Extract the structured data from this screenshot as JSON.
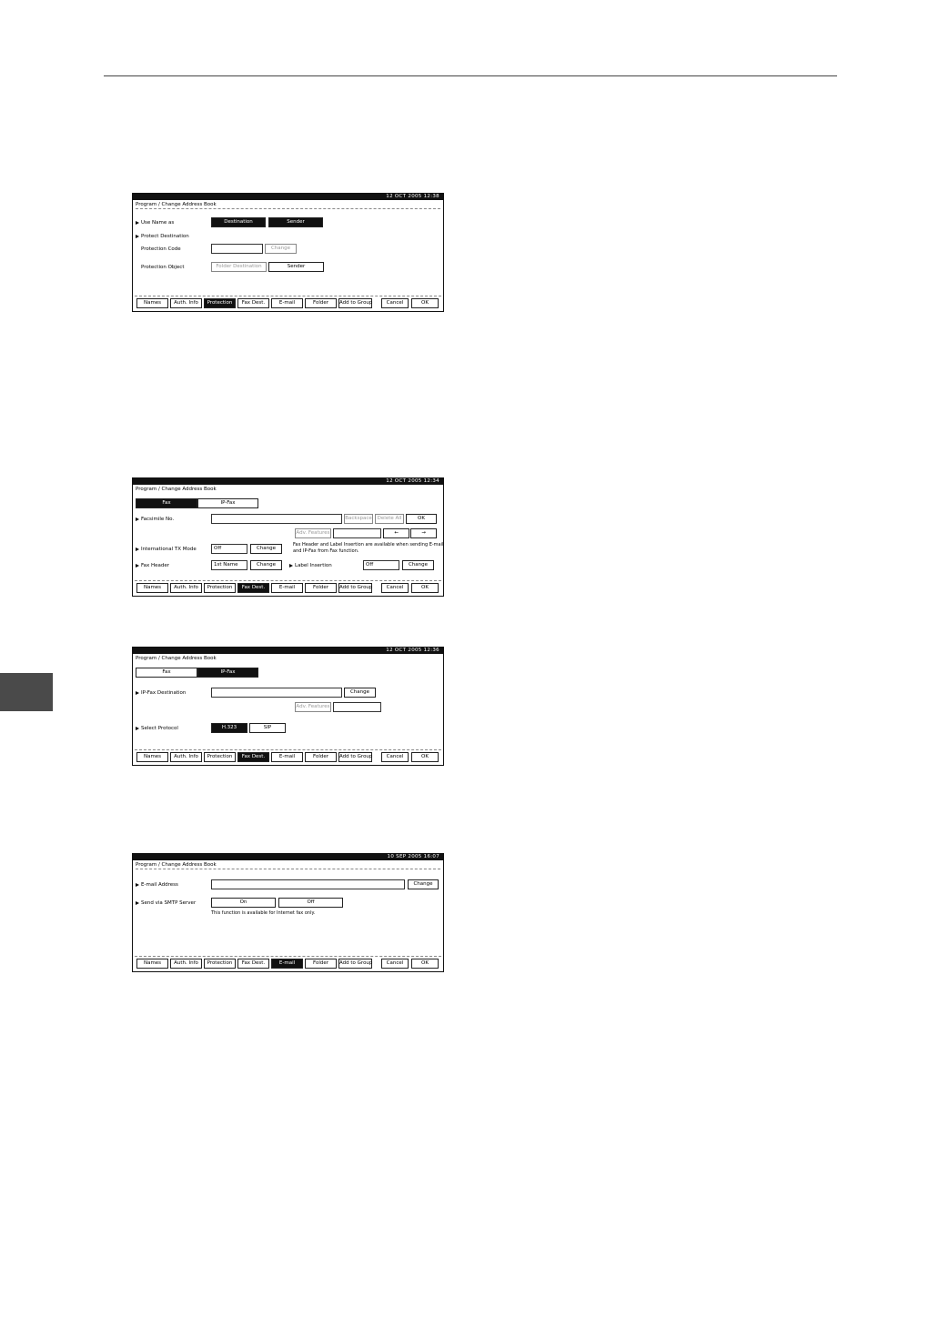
{
  "screens": [
    {
      "date": "12 OCT 2005 12:38",
      "title": "Program / Change Address Book",
      "labels": {
        "use_name_as": "Use Name as",
        "protect_destination": "Protect Destination",
        "protection_code": "Protection Code",
        "protection_object": "Protection Object"
      },
      "buttons": {
        "destination": "Destination",
        "sender": "Sender",
        "change": "Change",
        "folder_destination": "Folder Destination",
        "sender2": "Sender"
      },
      "bottom": {
        "names": "Names",
        "auth": "Auth. Info",
        "protection": "Protection",
        "fax_dest": "Fax Dest.",
        "email": "E-mail",
        "folder": "Folder",
        "add_group": "Add to Group",
        "cancel": "Cancel",
        "ok": "OK"
      }
    },
    {
      "date": "12 OCT 2005 12:34",
      "title": "Program / Change Address Book",
      "tabs": {
        "fax": "Fax",
        "ipfax": "IP-Fax"
      },
      "labels": {
        "facsimile_no": "Facsimile No.",
        "intl_tx": "International TX Mode",
        "fax_header": "Fax Header",
        "label_insertion": "Label Insertion"
      },
      "buttons": {
        "backspace": "Backspace",
        "delete_all": "Delete All",
        "ok": "OK",
        "adv_features": "Adv. Features",
        "left": "←",
        "right": "→",
        "change1": "Change",
        "change2": "Change",
        "change3": "Change"
      },
      "values": {
        "intl_tx": "Off",
        "fax_header": "1st Name",
        "label_insertion": "Off"
      },
      "note1": "Fax Header and Label Insertion are available when sending E-mail",
      "note2": "and IP-Fax from Fax function.",
      "bottom": {
        "names": "Names",
        "auth": "Auth. Info",
        "protection": "Protection",
        "fax_dest": "Fax Dest.",
        "email": "E-mail",
        "folder": "Folder",
        "add_group": "Add to Group",
        "cancel": "Cancel",
        "ok": "OK"
      }
    },
    {
      "date": "12 OCT 2005 12:36",
      "title": "Program / Change Address Book",
      "tabs": {
        "fax": "Fax",
        "ipfax": "IP-Fax"
      },
      "labels": {
        "ipfax_dest": "IP-Fax Destination",
        "select_protocol": "Select Protocol"
      },
      "buttons": {
        "change": "Change",
        "adv_features": "Adv. Features",
        "h323": "H.323",
        "sip": "SIP"
      },
      "bottom": {
        "names": "Names",
        "auth": "Auth. Info",
        "protection": "Protection",
        "fax_dest": "Fax Dest.",
        "email": "E-mail",
        "folder": "Folder",
        "add_group": "Add to Group",
        "cancel": "Cancel",
        "ok": "OK"
      }
    },
    {
      "date": "10 SEP 2005 16:07",
      "title": "Program / Change Address Book",
      "labels": {
        "email_address": "E-mail Address",
        "send_smtp": "Send via SMTP Server"
      },
      "buttons": {
        "change": "Change",
        "on": "On",
        "off": "Off"
      },
      "note": "This function is available for Internet fax only.",
      "bottom": {
        "names": "Names",
        "auth": "Auth. Info",
        "protection": "Protection",
        "fax_dest": "Fax Dest.",
        "email": "E-mail",
        "folder": "Folder",
        "add_group": "Add to Group",
        "cancel": "Cancel",
        "ok": "OK"
      }
    }
  ]
}
